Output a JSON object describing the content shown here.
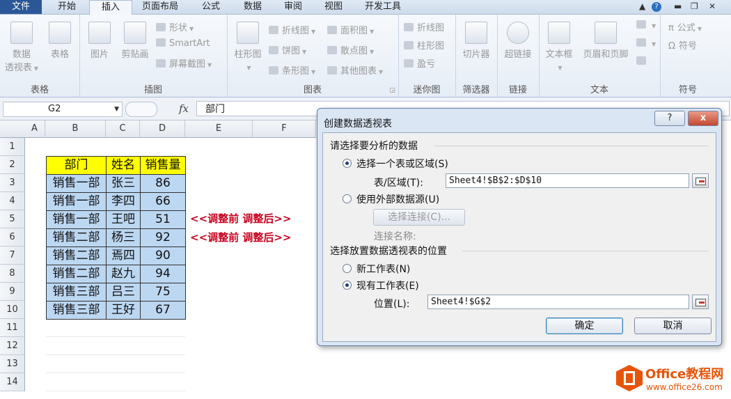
{
  "tabs": [
    "文件",
    "开始",
    "插入",
    "页面布局",
    "公式",
    "数据",
    "审阅",
    "视图",
    "开发工具"
  ],
  "ribbon": {
    "groups": {
      "tables": "表格",
      "illustrations": "插图",
      "charts": "图表",
      "sparklines": "迷你图",
      "filter": "筛选器",
      "links": "链接",
      "text": "文本",
      "symbols": "符号"
    },
    "pivot_line1": "数据",
    "pivot_line2": "透视表",
    "table": "表格",
    "picture": "图片",
    "clipart": "剪贴画",
    "shapes": "形状",
    "smartart": "SmartArt",
    "screenshot": "屏幕截图",
    "column_chart": "柱形图",
    "line_chart": "折线图",
    "pie_chart": "饼图",
    "bar_chart": "条形图",
    "area_chart": "面积图",
    "scatter_chart": "散点图",
    "other_charts": "其他图表",
    "spark_line": "折线图",
    "spark_column": "柱形图",
    "spark_winloss": "盈亏",
    "slicer": "切片器",
    "hyperlink": "超链接",
    "textbox": "文本框",
    "header_footer": "页眉和页脚",
    "formula": "公式",
    "symbol": "符号"
  },
  "formula_bar": {
    "name_box": "G2",
    "fx": "fx",
    "value": "部门"
  },
  "grid": {
    "columns": [
      "A",
      "B",
      "C",
      "D",
      "E",
      "F"
    ],
    "rows": [
      "1",
      "2",
      "3",
      "4",
      "5",
      "6",
      "7",
      "8",
      "9",
      "10",
      "11",
      "12",
      "13",
      "14"
    ],
    "table_header": [
      "部门",
      "姓名",
      "销售量"
    ],
    "table_rows": [
      [
        "销售一部",
        "张三",
        "86"
      ],
      [
        "销售一部",
        "李四",
        "66"
      ],
      [
        "销售一部",
        "王吧",
        "51"
      ],
      [
        "销售二部",
        "杨三",
        "92"
      ],
      [
        "销售二部",
        "焉四",
        "90"
      ],
      [
        "销售二部",
        "赵九",
        "94"
      ],
      [
        "销售三部",
        "吕三",
        "75"
      ],
      [
        "销售三部",
        "王好",
        "67"
      ]
    ],
    "annotation": "<<调整前  调整后>>",
    "colors": {
      "header_fill": "#ffff00",
      "data_fill": "#bcd7f2",
      "annotation": "#c8001e"
    }
  },
  "dialog": {
    "title": "创建数据透视表",
    "help": "?",
    "close": "x",
    "section1": "请选择要分析的数据",
    "opt_range": "选择一个表或区域(S)",
    "range_label": "表/区域(T):",
    "range_value": "Sheet4!$B$2:$D$10",
    "opt_external": "使用外部数据源(U)",
    "choose_conn": "选择连接(C)...",
    "conn_name": "连接名称:",
    "section2": "选择放置数据透视表的位置",
    "opt_new_ws": "新工作表(N)",
    "opt_existing_ws": "现有工作表(E)",
    "location_label": "位置(L):",
    "location_value": "Sheet4!$G$2",
    "ok": "确定",
    "cancel": "取消"
  },
  "watermark": {
    "title": "Office教程网",
    "url": "www.office26.com"
  }
}
